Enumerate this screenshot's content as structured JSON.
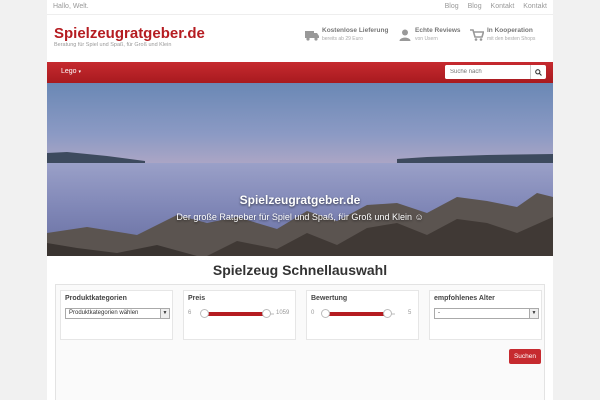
{
  "topbar": {
    "greeting": "Hallo, Welt.",
    "links": [
      "Blog",
      "Blog",
      "Kontakt",
      "Kontakt"
    ]
  },
  "header": {
    "brand": "Spielzeugratgeber.de",
    "tagline": "Beratung für Spiel und Spaß, für Groß und Klein",
    "features": [
      {
        "title": "Kostenlose Lieferung",
        "sub": "bereits ab 29 Euro",
        "icon": "truck-icon"
      },
      {
        "title": "Echte Reviews",
        "sub": "von Usern",
        "icon": "user-icon"
      },
      {
        "title": "In Kooperation",
        "sub": "mit den besten Shops",
        "icon": "cart-icon"
      }
    ]
  },
  "nav": {
    "dropdown_label": "Lego",
    "search_placeholder": "Suche nach"
  },
  "hero": {
    "title": "Spielzeugratgeber.de",
    "subtitle": "Der große Ratgeber für Spiel und Spaß, für Groß und Klein ☺"
  },
  "quick": {
    "title": "Spielzeug Schnellauswahl",
    "categories": {
      "label": "Produktkategorien",
      "selected": "Produktkategorien wählen"
    },
    "price": {
      "label": "Preis",
      "min": "6",
      "max": "1059"
    },
    "rating": {
      "label": "Bewertung",
      "min": "0",
      "max": "5"
    },
    "age": {
      "label": "empfohlenes Alter",
      "selected": "-"
    },
    "submit_label": "Suchen"
  },
  "colors": {
    "accent": "#b51c21",
    "navbar": "#c62a2f"
  }
}
